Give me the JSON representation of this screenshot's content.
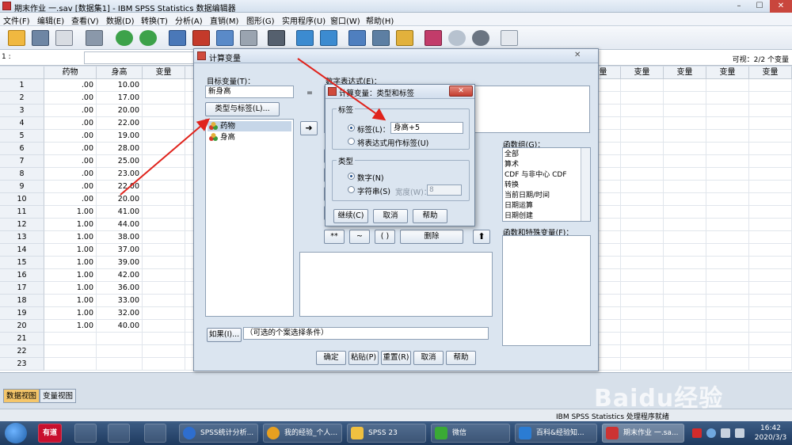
{
  "window": {
    "title": "期末作业 一.sav [数据集1] - IBM SPSS Statistics 数据编辑器",
    "min": "–",
    "max": "☐",
    "close": "✕"
  },
  "menu": [
    "文件(F)",
    "编辑(E)",
    "查看(V)",
    "数据(D)",
    "转换(T)",
    "分析(A)",
    "直销(M)",
    "图形(G)",
    "实用程序(U)",
    "窗口(W)",
    "帮助(H)"
  ],
  "editbar": {
    "cellref": "1 :",
    "visible": "可视：2/2 个变量"
  },
  "grid": {
    "headers": [
      "药物",
      "身高",
      "变量",
      "变量",
      "变量",
      "变量",
      "变量",
      "变量",
      "变量",
      "变量",
      "变量"
    ],
    "rows": [
      {
        "n": "1",
        "a": ".00",
        "b": "10.00"
      },
      {
        "n": "2",
        "a": ".00",
        "b": "17.00"
      },
      {
        "n": "3",
        "a": ".00",
        "b": "20.00"
      },
      {
        "n": "4",
        "a": ".00",
        "b": "22.00"
      },
      {
        "n": "5",
        "a": ".00",
        "b": "19.00"
      },
      {
        "n": "6",
        "a": ".00",
        "b": "28.00"
      },
      {
        "n": "7",
        "a": ".00",
        "b": "25.00"
      },
      {
        "n": "8",
        "a": ".00",
        "b": "23.00"
      },
      {
        "n": "9",
        "a": ".00",
        "b": "22.00"
      },
      {
        "n": "10",
        "a": ".00",
        "b": "20.00"
      },
      {
        "n": "11",
        "a": "1.00",
        "b": "41.00"
      },
      {
        "n": "12",
        "a": "1.00",
        "b": "44.00"
      },
      {
        "n": "13",
        "a": "1.00",
        "b": "38.00"
      },
      {
        "n": "14",
        "a": "1.00",
        "b": "37.00"
      },
      {
        "n": "15",
        "a": "1.00",
        "b": "39.00"
      },
      {
        "n": "16",
        "a": "1.00",
        "b": "42.00"
      },
      {
        "n": "17",
        "a": "1.00",
        "b": "36.00"
      },
      {
        "n": "18",
        "a": "1.00",
        "b": "33.00"
      },
      {
        "n": "19",
        "a": "1.00",
        "b": "32.00"
      },
      {
        "n": "20",
        "a": "1.00",
        "b": "40.00"
      },
      {
        "n": "21",
        "a": "",
        "b": ""
      },
      {
        "n": "22",
        "a": "",
        "b": ""
      },
      {
        "n": "23",
        "a": "",
        "b": ""
      }
    ]
  },
  "tabs": {
    "data_view": "数据视图",
    "variable_view": "变量视图"
  },
  "status": {
    "text": "IBM SPSS Statistics 处理程序就绪"
  },
  "dialog": {
    "title": "计算变量",
    "close": "✕",
    "target_label": "目标变量(T)：",
    "target_value": "新身高",
    "equals": "=",
    "expr_label": "数字表达式(E)：",
    "expr_value": "药",
    "type_label_button": "类型与标签(L)...",
    "variables": [
      "药物",
      "身高"
    ],
    "func_group_label": "函数组(G)：",
    "func_groups": [
      "全部",
      "算术",
      "CDF 与非中心 CDF",
      "转换",
      "当前日期/时间",
      "日期运算",
      "日期创建"
    ],
    "func_special_label": "函数和特殊变量(F)：",
    "calc_keys": [
      "**",
      "~",
      "( )"
    ],
    "delete": "删除",
    "if_button": "如果(I)...",
    "if_text": "（可选的个案选择条件）",
    "buttons": [
      "确定",
      "粘贴(P)",
      "重置(R)",
      "取消",
      "帮助"
    ]
  },
  "subdialog": {
    "title": "计算变量：类型和标签",
    "close": "✕",
    "label_group": "标签",
    "label_radio": "标签(L)：",
    "label_value": "身高+5",
    "use_expr_radio": "将表达式用作标签(U)",
    "type_group": "类型",
    "numeric_radio": "数字(N)",
    "string_radio": "字符串(S)",
    "width_label": "宽度(W)：",
    "width_value": "8",
    "buttons": [
      "继续(C)",
      "取消",
      "帮助"
    ]
  },
  "taskbar": {
    "items": [
      "有道",
      "SPSS统计分析...",
      "我的经验_个人...",
      "SPSS 23",
      "微信",
      "百科&经验知...",
      "期末作业 一.sa..."
    ],
    "time": "16:42",
    "date": "2020/3/3"
  },
  "watermark": "Baidu经验",
  "colors": {
    "arrow": "#e0231c",
    "active_tab": "#f5c66a",
    "title_bar": "#d4e0ee"
  }
}
